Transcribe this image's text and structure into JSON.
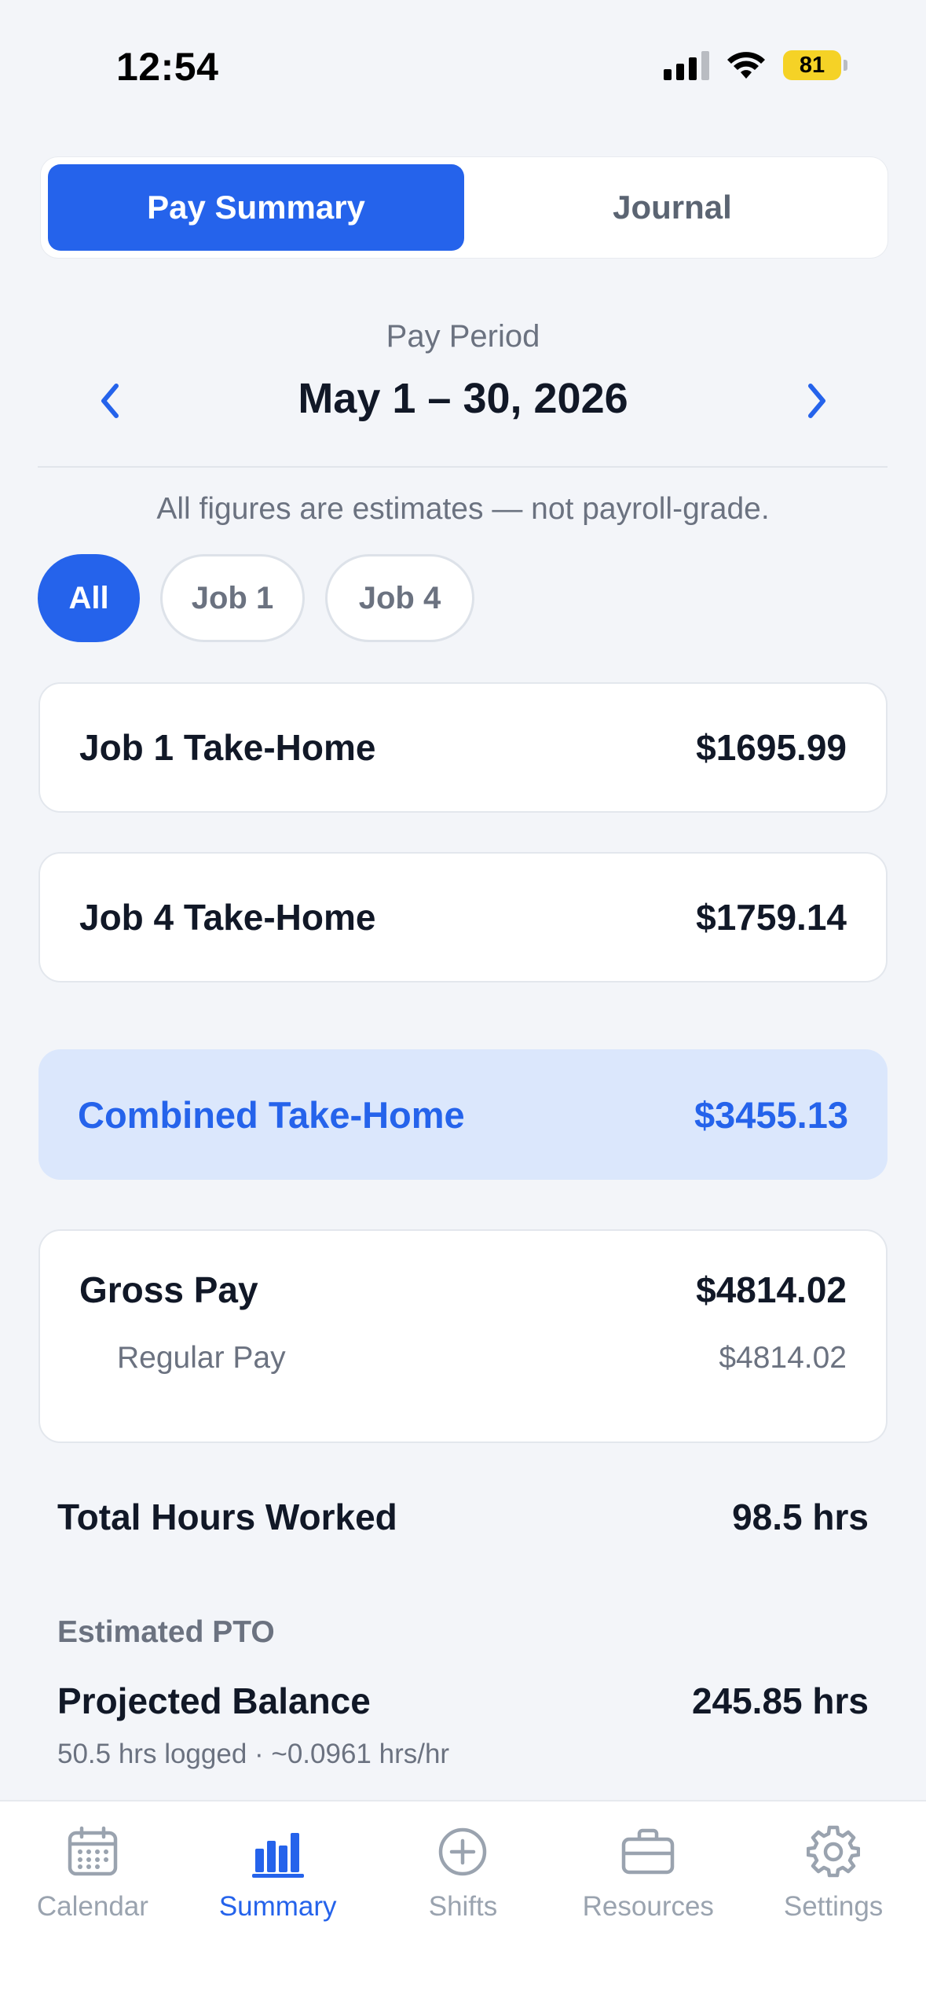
{
  "status_bar": {
    "time": "12:54",
    "battery": "81"
  },
  "segmented": {
    "tabs": [
      "Pay Summary",
      "Journal"
    ],
    "active": 0
  },
  "period": {
    "caption": "Pay Period",
    "title": "May 1 – 30, 2026"
  },
  "disclaimer": "All figures are estimates — not payroll-grade.",
  "filters": {
    "options": [
      "All",
      "Job 1",
      "Job 4"
    ],
    "active": 0
  },
  "take_home": [
    {
      "label": "Job 1 Take-Home",
      "value": "$1695.99"
    },
    {
      "label": "Job 4 Take-Home",
      "value": "$1759.14"
    }
  ],
  "combined": {
    "label": "Combined Take-Home",
    "value": "$3455.13"
  },
  "gross": {
    "label": "Gross Pay",
    "value": "$4814.02",
    "regular_label": "Regular Pay",
    "regular_value": "$4814.02"
  },
  "hours": {
    "label": "Total Hours Worked",
    "value": "98.5 hrs"
  },
  "pto": {
    "heading": "Estimated PTO",
    "label": "Projected Balance",
    "value": "245.85 hrs",
    "meta": "50.5 hrs logged · ~0.0961 hrs/hr"
  },
  "tab_bar": {
    "items": [
      {
        "label": "Calendar",
        "icon": "calendar-icon"
      },
      {
        "label": "Summary",
        "icon": "bar-chart-icon"
      },
      {
        "label": "Shifts",
        "icon": "plus-circle-icon"
      },
      {
        "label": "Resources",
        "icon": "briefcase-icon"
      },
      {
        "label": "Settings",
        "icon": "gear-icon"
      }
    ],
    "active": 1
  },
  "colors": {
    "accent": "#2563EB",
    "accent_soft": "#DBE7FC",
    "muted": "#6B7280",
    "background": "#F3F5F9"
  }
}
